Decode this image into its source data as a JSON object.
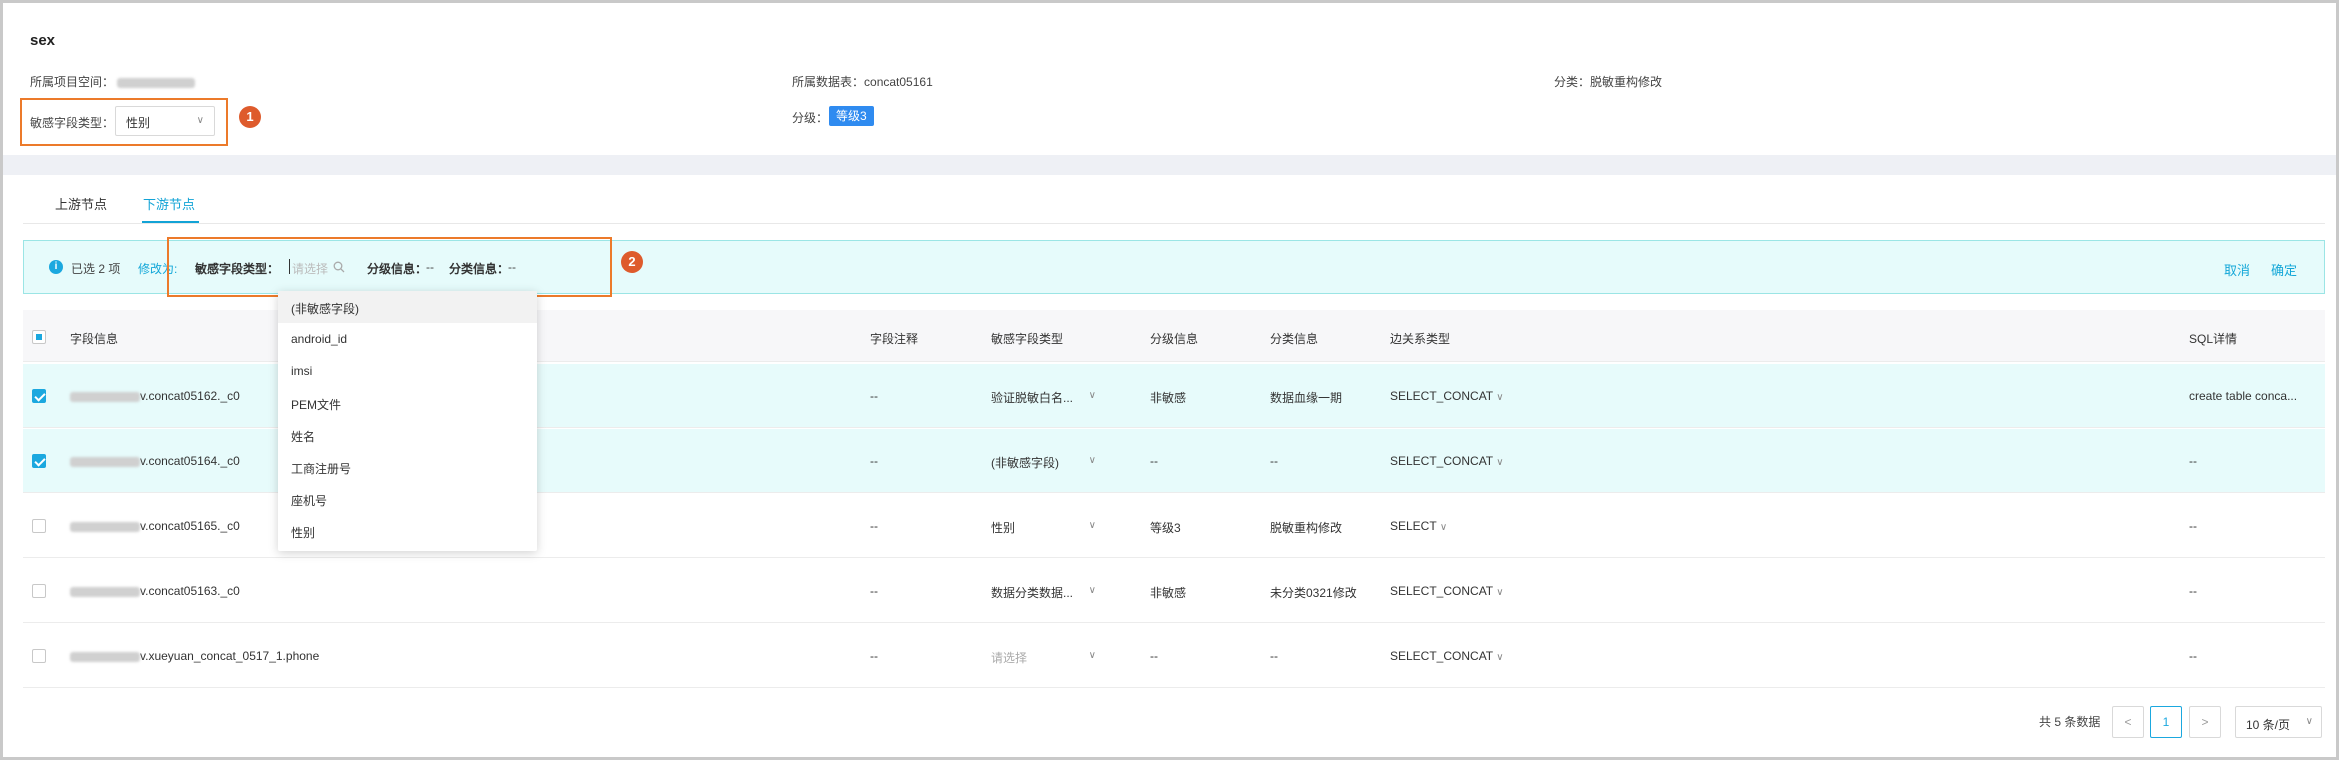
{
  "header": {
    "title": "sex",
    "project_label": "所属项目空间：",
    "table_label": "所属数据表：",
    "table_value": "concat05161",
    "category_label": "分类：",
    "category_value": "脱敏重构修改",
    "sensitive_type_label": "敏感字段类型：",
    "sensitive_type_value": "性别",
    "level_label": "分级：",
    "level_value": "等级3"
  },
  "annotations": {
    "marker_1": "1",
    "marker_2": "2"
  },
  "tabs": [
    {
      "label": "上游节点"
    },
    {
      "label": "下游节点",
      "active": true
    }
  ],
  "batch_bar": {
    "selected_text": "已选 2 项",
    "modify_link": "修改为:",
    "sensitive_type_label": "敏感字段类型：",
    "search_placeholder": "请选择",
    "level_label": "分级信息：",
    "level_value": "--",
    "category_label": "分类信息：",
    "category_value": "--",
    "cancel": "取消",
    "confirm": "确定"
  },
  "dropdown": {
    "options": [
      "(非敏感字段)",
      "android_id",
      "imsi",
      "PEM文件",
      "姓名",
      "工商注册号",
      "座机号",
      "性别"
    ],
    "highlighted_index": 0
  },
  "table": {
    "columns": [
      "字段信息",
      "字段注释",
      "敏感字段类型",
      "分级信息",
      "分类信息",
      "边关系类型",
      "SQL详情"
    ],
    "rows": [
      {
        "selected": true,
        "field": "v.concat05162._c0",
        "comment": "--",
        "sensitive_type": "验证脱敏白名...",
        "level": "非敏感",
        "category": "数据血缘一期",
        "edge": "SELECT_CONCAT",
        "sql": "create table conca..."
      },
      {
        "selected": true,
        "field": "v.concat05164._c0",
        "comment": "--",
        "sensitive_type": "(非敏感字段)",
        "level": "--",
        "category": "--",
        "edge": "SELECT_CONCAT",
        "sql": "--"
      },
      {
        "selected": false,
        "field": "v.concat05165._c0",
        "comment": "--",
        "sensitive_type": "性别",
        "level": "等级3",
        "category": "脱敏重构修改",
        "edge": "SELECT",
        "sql": "--"
      },
      {
        "selected": false,
        "field": "v.concat05163._c0",
        "comment": "--",
        "sensitive_type": "数据分类数据...",
        "level": "非敏感",
        "category": "未分类0321修改",
        "edge": "SELECT_CONCAT",
        "sql": "--"
      },
      {
        "selected": false,
        "field": "v.xueyuan_concat_0517_1.phone",
        "comment": "--",
        "sensitive_type": "请选择",
        "sensitive_placeholder": true,
        "level": "--",
        "category": "--",
        "edge": "SELECT_CONCAT",
        "sql": "--"
      }
    ]
  },
  "pagination": {
    "total_text": "共 5 条数据",
    "prev": "<",
    "current_page": "1",
    "next": ">",
    "page_size": "10 条/页"
  },
  "colors": {
    "accent": "#13a7d8",
    "annotation_orange": "#ec7a2a",
    "level_tag": "#2f8bf0",
    "selected_row": "#e7fbfb"
  }
}
